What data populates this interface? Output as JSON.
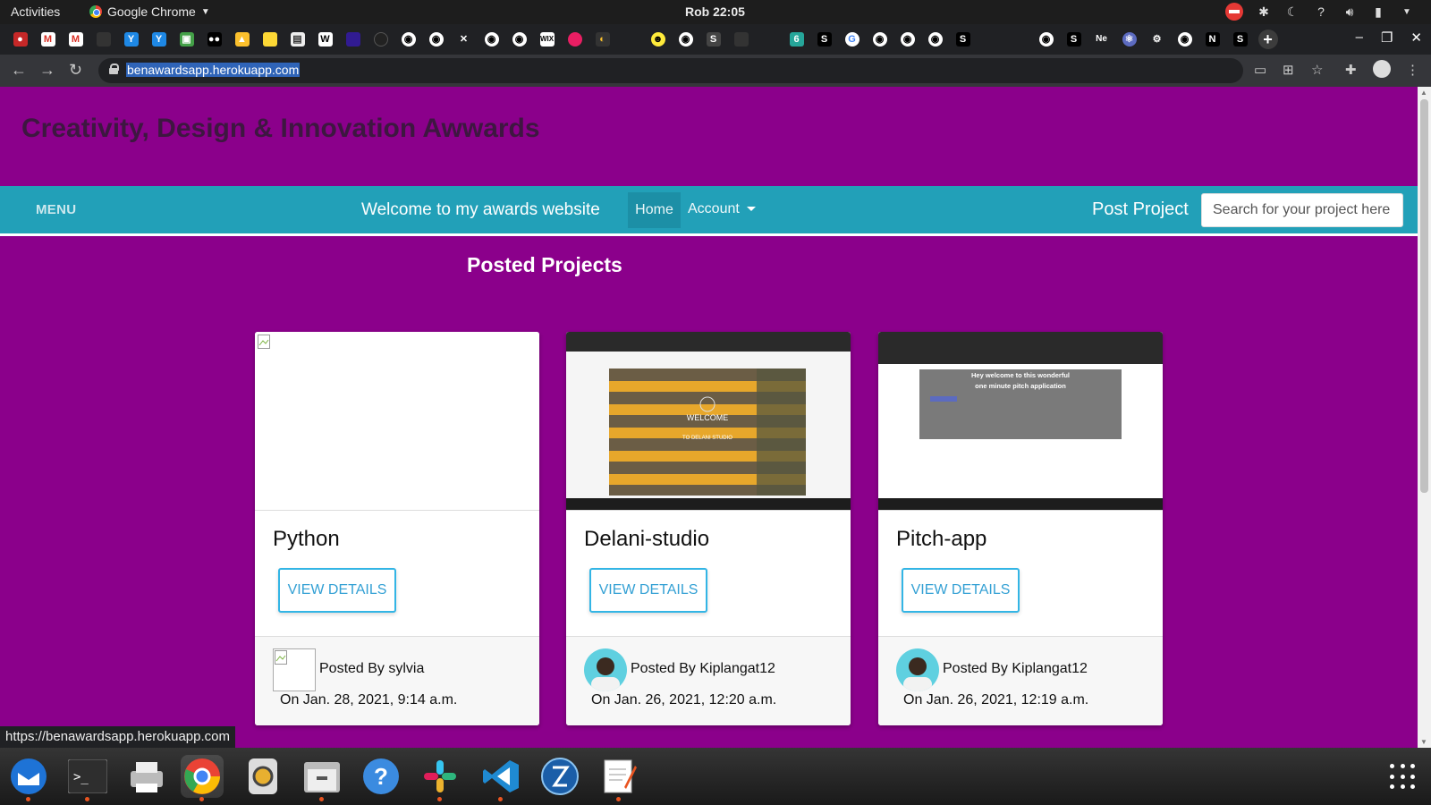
{
  "topbar": {
    "activities": "Activities",
    "app_name": "Google Chrome",
    "clock": "Rob 22:05",
    "tray_icons": [
      "no-entry-icon",
      "slack-tray-icon",
      "night-light-icon",
      "help-icon",
      "volume-icon",
      "battery-icon"
    ]
  },
  "browser": {
    "url": "benawardsapp.herokuapp.com",
    "status_url": "https://benawardsapp.herokuapp.com"
  },
  "site": {
    "title": "Creativity, Design & Innovation Awwards",
    "menu_label": "MENU",
    "welcome": "Welcome to my awards website",
    "nav_home": "Home",
    "nav_account": "Account",
    "post_project": "Post Project",
    "search_placeholder": "Search for your project here",
    "section_title": "Posted Projects"
  },
  "projects": [
    {
      "title": "Python",
      "button": "VIEW DETAILS",
      "posted_by": "Posted By sylvia",
      "date": "On Jan. 28, 2021, 9:14 a.m."
    },
    {
      "title": "Delani-studio",
      "button": "VIEW DETAILS",
      "posted_by": "Posted By Kiplangat12",
      "date": "On Jan. 26, 2021, 12:20 a.m.",
      "thumb_text": [
        "WELCOME",
        "TO DELANI STUDIO"
      ]
    },
    {
      "title": "Pitch-app",
      "button": "VIEW DETAILS",
      "posted_by": "Posted By Kiplangat12",
      "date": "On Jan. 26, 2021, 12:19 a.m.",
      "thumb_text": [
        "Hey welcome to this wonderful",
        "one minute pitch application"
      ]
    }
  ],
  "colors": {
    "page_bg": "#8b008b",
    "navbar_bg": "#22a0b8",
    "button_border": "#33b5e5"
  }
}
